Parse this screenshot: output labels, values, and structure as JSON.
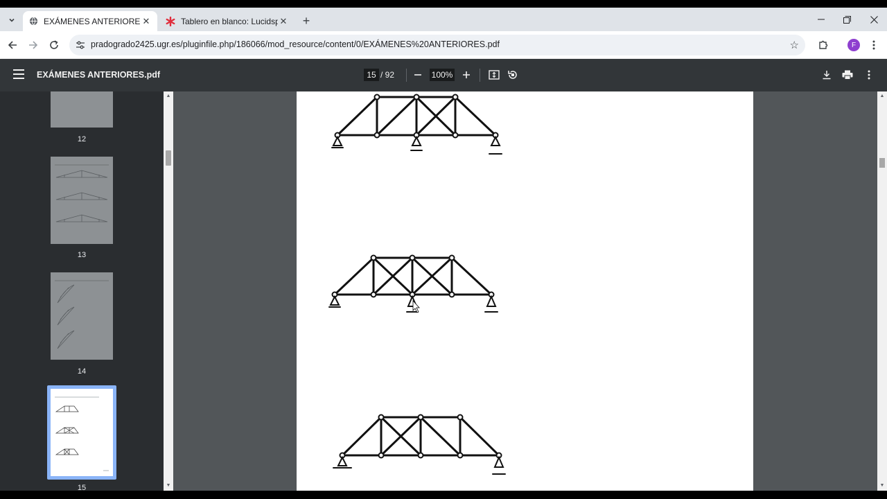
{
  "browser": {
    "tabs": [
      {
        "title": "EXÁMENES ANTERIORES.pdf",
        "active": true
      },
      {
        "title": "Tablero en blanco: Lucidspark",
        "active": false
      }
    ],
    "url": "pradogrado2425.ugr.es/pluginfile.php/186066/mod_resource/content/0/EXÁMENES%20ANTERIORES.pdf",
    "profile_initial": "F",
    "profile_color": "#8e3fcf"
  },
  "pdf": {
    "title": "EXÁMENES ANTERIORES.pdf",
    "current_page": "15",
    "total_pages": "/ 92",
    "zoom": "100%",
    "thumbnails": [
      {
        "number": "12",
        "selected": false
      },
      {
        "number": "13",
        "selected": false
      },
      {
        "number": "14",
        "selected": false
      },
      {
        "number": "15",
        "selected": true
      }
    ]
  },
  "icons": {
    "tab_search": "chevron-down-icon",
    "favicon_1": "globe-icon",
    "favicon_2": "lucidspark-asterisk-icon",
    "new_tab": "plus-icon",
    "back": "arrow-left-icon",
    "forward": "arrow-right-icon",
    "reload": "reload-icon",
    "site_info": "tune-icon",
    "bookmark": "star-icon",
    "extensions": "puzzle-icon",
    "menu": "kebab-icon",
    "sidebar_toggle": "hamburger-icon",
    "zoom_out": "minus-icon",
    "zoom_in": "plus-icon",
    "fit": "fit-page-icon",
    "rotate": "rotate-icon",
    "download": "download-icon",
    "print": "print-icon",
    "more": "kebab-icon"
  }
}
